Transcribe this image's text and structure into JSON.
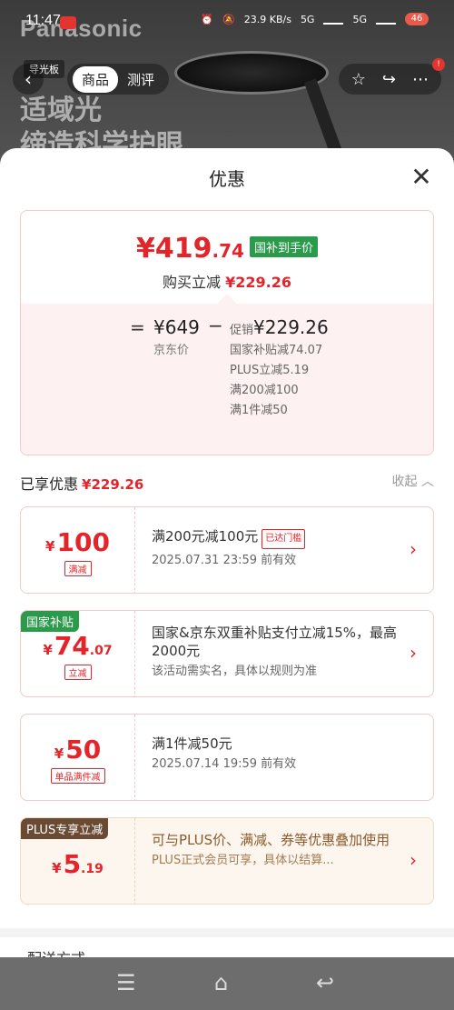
{
  "status_bar": {
    "time": "11:47",
    "net_speed": "23.9 KB/s",
    "net1": "5G",
    "net2": "5G",
    "battery": "46"
  },
  "backdrop": {
    "brand": "Panasonic",
    "tagline_1": "适域光",
    "tagline_2": "缔造科学护眼",
    "category_chip": "导光板"
  },
  "nav": {
    "tabs": [
      "商品",
      "测评"
    ],
    "active_tab": 0,
    "icons": [
      "back-icon",
      "star-icon",
      "share-icon",
      "more-icon"
    ],
    "badge": "!"
  },
  "sheet": {
    "title": "优惠",
    "summary": {
      "final_price_int": "¥419",
      "final_price_dec": ".74",
      "gov_tag": "国补到手价",
      "buy_reduce_label": "购买立减",
      "buy_reduce_amount": "¥229.26",
      "eq": "=",
      "jd_price": "¥649",
      "jd_label": "京东价",
      "minus": "−",
      "promo_label": "促销",
      "promo_amount": "¥229.26",
      "promo_items": [
        "国家补贴减74.07",
        "PLUS立减5.19",
        "满200减100",
        "满1件减50"
      ]
    },
    "enjoyed": {
      "label": "已享优惠",
      "amount": "¥229.26",
      "collapse": "收起 ︿"
    },
    "cards": [
      {
        "corner": "",
        "yen": "¥",
        "amount": "100",
        "dec": "",
        "badge": "满减",
        "line1": "满200元减100元",
        "reached": "已达门槛",
        "line2": "2025.07.31 23:59 前有效"
      },
      {
        "corner": "国家补贴",
        "yen": "¥",
        "amount": "74",
        "dec": ".07",
        "badge": "立减",
        "line1": "国家&京东双重补贴支付立减15%，最高2000元",
        "reached": "",
        "line2": "该活动需实名，具体以规则为准"
      },
      {
        "corner": "",
        "yen": "¥",
        "amount": "50",
        "dec": "",
        "badge": "单品满件减",
        "line1": "满1件减50元",
        "reached": "",
        "line2": "2025.07.14 19:59 前有效"
      },
      {
        "corner": "PLUS专享立减",
        "yen": "¥",
        "amount": "5",
        "dec": ".19",
        "badge": "",
        "line1": "可与PLUS价、满减、券等优惠叠加使用",
        "reached": "",
        "line2": "PLUS正式会员可享，具体以结算..."
      }
    ],
    "cut_text": "配送方式"
  },
  "colors": {
    "accent_red": "#e3242b",
    "gov_green": "#2b9b4b",
    "plus_brown": "#6b4a34"
  }
}
